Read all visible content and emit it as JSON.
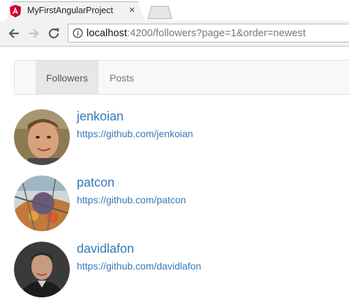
{
  "browser": {
    "tab_title": "MyFirstAngularProject",
    "tab_close": "×",
    "url_host": "localhost",
    "url_rest": ":4200/followers?page=1&order=newest",
    "favicon": "angular-logo-icon",
    "colors": {
      "favicon": "#dd0031"
    }
  },
  "nav": {
    "items": [
      {
        "label": "Followers",
        "active": true
      },
      {
        "label": "Posts",
        "active": false
      }
    ]
  },
  "followers": [
    {
      "login": "jenkoian",
      "url": "https://github.com/jenkoian"
    },
    {
      "login": "patcon",
      "url": "https://github.com/patcon"
    },
    {
      "login": "davidlafon",
      "url": "https://github.com/davidlafon"
    }
  ],
  "colors": {
    "link": "#337ab7"
  }
}
